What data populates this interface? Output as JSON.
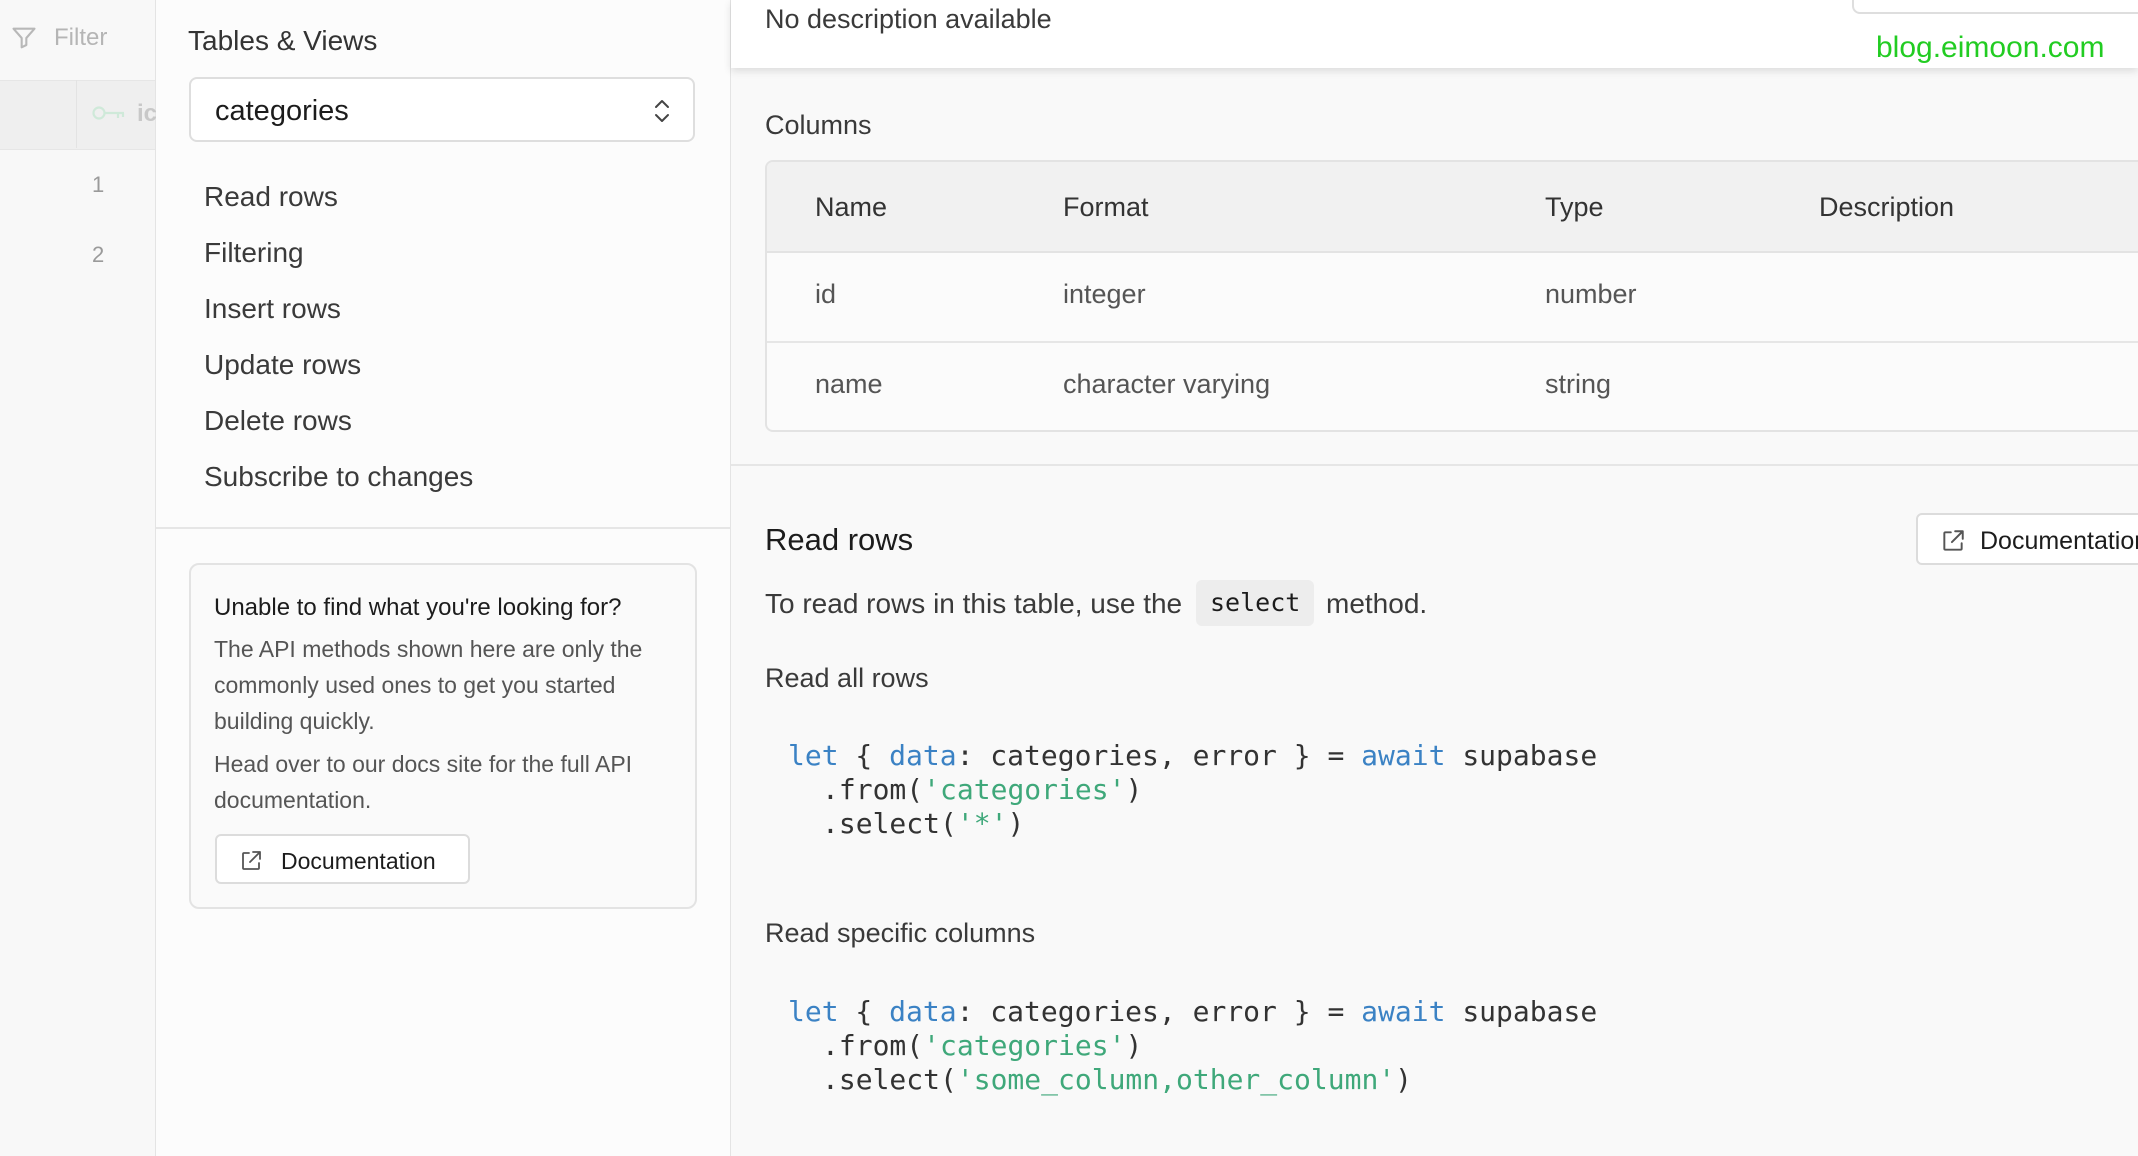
{
  "grid": {
    "filter_label": "Filter",
    "column_label": "ic",
    "row_numbers": [
      "1",
      "2"
    ]
  },
  "menu": {
    "title": "Tables & Views",
    "selected_table": "categories",
    "items": [
      "Read rows",
      "Filtering",
      "Insert rows",
      "Update rows",
      "Delete rows",
      "Subscribe to changes"
    ]
  },
  "help_card": {
    "heading": "Unable to find what you're looking for?",
    "p1": "The API methods shown here are only the commonly used ones to get you started building quickly.",
    "p2": "Head over to our docs site for the full API documentation.",
    "button_label": "Documentation"
  },
  "main": {
    "description": "No description available",
    "watermark": "blog.eimoon.com",
    "columns_title": "Columns",
    "columns_headers": [
      "Name",
      "Format",
      "Type",
      "Description"
    ],
    "columns_rows": [
      {
        "name": "id",
        "format": "integer",
        "type": "number",
        "description": ""
      },
      {
        "name": "name",
        "format": "character varying",
        "type": "string",
        "description": ""
      }
    ],
    "read_rows": {
      "title": "Read rows",
      "doc_button": "Documentation",
      "desc_pre": "To read rows in this table, use the",
      "method": "select",
      "desc_post": "method.",
      "all_title": "Read all rows",
      "specific_title": "Read specific columns"
    },
    "code": {
      "let": "let",
      "open": " { ",
      "data_key": "data",
      "destructure_rest": ": categories, error } = ",
      "await": "await",
      "client": " supabase",
      "from_call": ".from(",
      "table_str": "'categories'",
      "close": ")",
      "select_call": ".select(",
      "star_str": "'*'",
      "cols_str": "'some_column,other_column'"
    }
  },
  "colors": {
    "keyword": "#3b82c4",
    "string": "#3fa87a",
    "watermark": "#22cc22"
  }
}
